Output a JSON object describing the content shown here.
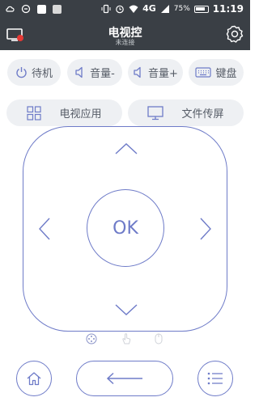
{
  "status_bar": {
    "signal_text": "4G",
    "battery_percent": "75%",
    "time": "11:19"
  },
  "title_bar": {
    "title": "电视控",
    "subtitle": "未连接"
  },
  "quick_buttons": {
    "standby": "待机",
    "volume_down": "音量-",
    "volume_up": "音量+",
    "keyboard": "键盘"
  },
  "feature_buttons": {
    "tv_apps": "电视应用",
    "file_cast": "文件传屏"
  },
  "dpad": {
    "ok_label": "OK"
  },
  "colors": {
    "accent": "#6e7bc8",
    "title_bar_bg": "#3a3f45",
    "pill_bg": "#eef0f3"
  }
}
